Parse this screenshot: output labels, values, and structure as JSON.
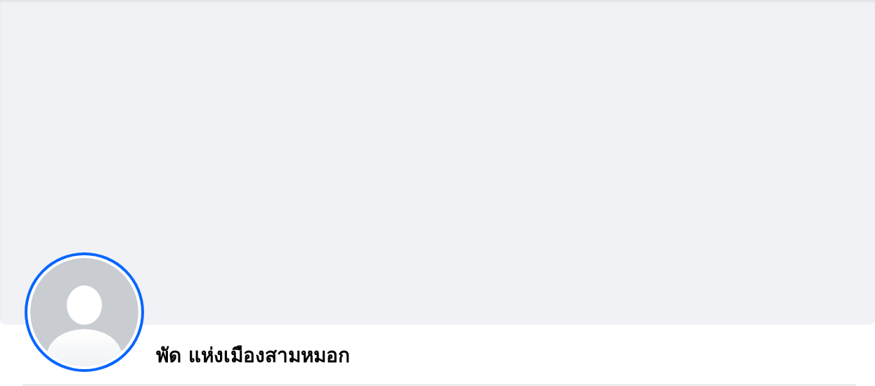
{
  "profile": {
    "name": "พัด แห่งเมืองสามหมอก"
  }
}
